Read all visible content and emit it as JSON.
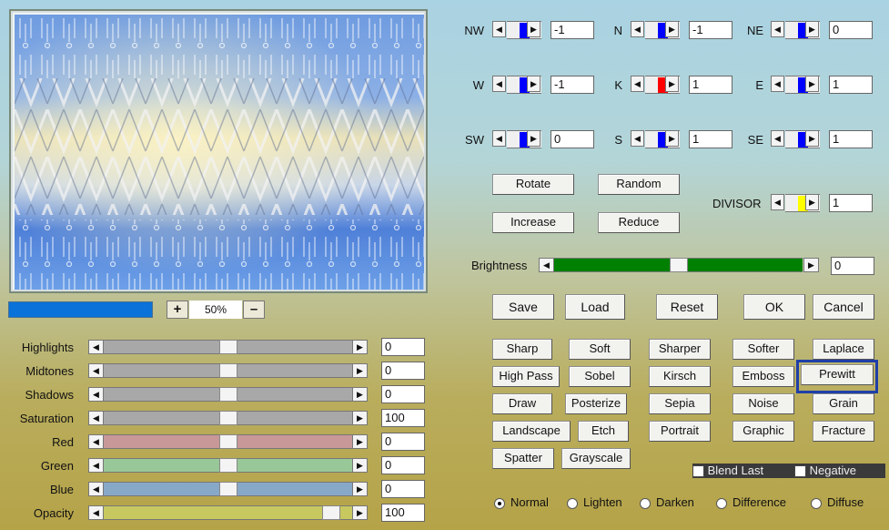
{
  "preview": {
    "zoom_in": "+",
    "zoom_value": "50%",
    "zoom_out": "–"
  },
  "matrix": {
    "cells": [
      {
        "label": "NW",
        "value": "-1",
        "color": "#0000ff"
      },
      {
        "label": "N",
        "value": "-1",
        "color": "#0000ff"
      },
      {
        "label": "NE",
        "value": "0",
        "color": "#0000ff"
      },
      {
        "label": "W",
        "value": "-1",
        "color": "#0000ff"
      },
      {
        "label": "K",
        "value": "1",
        "color": "#ff0000"
      },
      {
        "label": "E",
        "value": "1",
        "color": "#0000ff"
      },
      {
        "label": "SW",
        "value": "0",
        "color": "#0000ff"
      },
      {
        "label": "S",
        "value": "1",
        "color": "#0000ff"
      },
      {
        "label": "SE",
        "value": "1",
        "color": "#0000ff"
      }
    ],
    "divisor_label": "DIVISOR",
    "divisor_value": "1",
    "divisor_color": "#ffff00"
  },
  "actions": {
    "rotate": "Rotate",
    "random": "Random",
    "increase": "Increase",
    "reduce": "Reduce"
  },
  "brightness": {
    "label": "Brightness",
    "value": "0",
    "level": 0.5,
    "color": "#008000"
  },
  "main_buttons": {
    "save": "Save",
    "load": "Load",
    "reset": "Reset",
    "ok": "OK",
    "cancel": "Cancel"
  },
  "adjustments": [
    {
      "label": "Highlights",
      "value": "0",
      "level": 0.5,
      "color": "#a8a8a8"
    },
    {
      "label": "Midtones",
      "value": "0",
      "level": 0.5,
      "color": "#a8a8a8"
    },
    {
      "label": "Shadows",
      "value": "0",
      "level": 0.5,
      "color": "#a8a8a8"
    },
    {
      "label": "Saturation",
      "value": "100",
      "level": 0.5,
      "color": "#a8a8a8"
    },
    {
      "label": "Red",
      "value": "0",
      "level": 0.5,
      "color": "#c89898"
    },
    {
      "label": "Green",
      "value": "0",
      "level": 0.5,
      "color": "#98c898"
    },
    {
      "label": "Blue",
      "value": "0",
      "level": 0.5,
      "color": "#88a8c8"
    },
    {
      "label": "Opacity",
      "value": "100",
      "level": 0.95,
      "color": "#c8c860"
    }
  ],
  "presets": {
    "row1": [
      "Sharp",
      "Soft",
      "Sharper",
      "Softer",
      "Laplace"
    ],
    "row2": [
      "High Pass",
      "Sobel",
      "Kirsch",
      "Emboss",
      "Prewitt"
    ],
    "row3": [
      "Draw",
      "Posterize",
      "Sepia",
      "Noise",
      "Grain"
    ],
    "row4": [
      "Landscape",
      "Etch",
      "Portrait",
      "Graphic",
      "Fracture"
    ],
    "row5": [
      "Spatter",
      "Grayscale"
    ],
    "selected": "Prewitt"
  },
  "options": {
    "blend_last": "Blend Last",
    "negative": "Negative"
  },
  "blend_modes": [
    "Normal",
    "Lighten",
    "Darken",
    "Difference",
    "Diffuse"
  ],
  "blend_selected": "Normal"
}
